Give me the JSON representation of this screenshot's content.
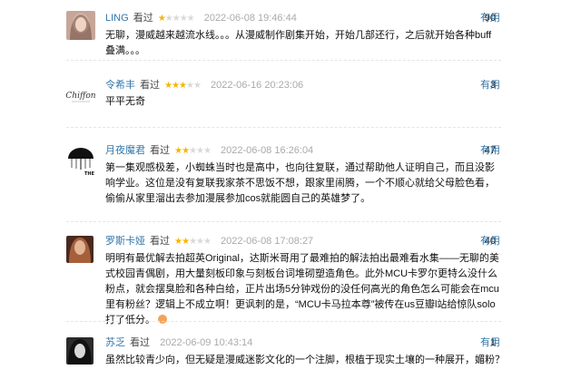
{
  "reviews": [
    {
      "user": "LING",
      "status": "看过",
      "rating": 1,
      "time": "2022-06-08 19:46:44",
      "votes": "90",
      "useful_label": "有用",
      "text": "无聊，漫威越来越流水线。。。从漫威制作剧集开始，开始几部还行，之后就开始各种buff叠满。。。",
      "avatar_colors": [
        "#7d5a4f",
        "#d9b5a0"
      ]
    },
    {
      "user": "令希丰",
      "status": "看过",
      "rating": 3,
      "time": "2022-06-16 20:23:06",
      "votes": "3",
      "useful_label": "有用",
      "text": "平平无奇",
      "avatar_text": "Chiffon",
      "avatar_colors": [
        "#ffffff",
        "#555555"
      ]
    },
    {
      "user": "月夜魔君",
      "status": "看过",
      "rating": 2,
      "time": "2022-06-08 16:26:04",
      "votes": "47",
      "useful_label": "有用",
      "text": "第一集观感极差，小蜘蛛当时也是高中，也向往复联，通过帮助他人证明自己，而且没影响学业。这位是没有复联我家茶不思饭不想，跟家里闹腾，一个不顺心就给父母脸色看，偷偷从家里溜出去参加漫展参加cos就能圆自己的英雄梦了。",
      "avatar_text": "THE",
      "avatar_colors": [
        "#ffffff",
        "#111111"
      ]
    },
    {
      "user": "罗斯卡娅",
      "status": "看过",
      "rating": 2,
      "time": "2022-06-08 17:08:27",
      "votes": "40",
      "useful_label": "有用",
      "text": "明明有最优解去拍超英Original，达斯米哥用了最难拍的解法拍出最难看水集——无聊的美式校园青偶剧，用大量刻板印象与刻板台词堆砌塑造角色。此外MCU卡罗尔更特么没什么粉点，就会摆臭脸和各种白给，正片出场5分钟戏份的没任何高光的角色怎么可能会在mcu里有粉丝？逻辑上不成立啊！更讽刺的是，“MCU卡马拉本尊”被传在us豆瓣l站给惊队solo打了低分。",
      "avatar_colors": [
        "#6b3a2a",
        "#c98a5a"
      ]
    },
    {
      "user": "苏乏",
      "status": "看过",
      "rating": 0,
      "time": "2022-06-09 10:43:14",
      "votes": "1",
      "useful_label": "有用",
      "text": "虽然比较青少向，但无疑是漫威迷影文化的一个注脚，根植于现实土壤的一种展开，媚粉？反正就很迪士尼",
      "avatar_colors": [
        "#222222",
        "#bbbbbb"
      ]
    }
  ]
}
